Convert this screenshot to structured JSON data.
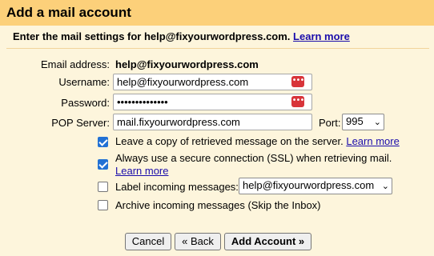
{
  "title": "Add a mail account",
  "intro": {
    "text": "Enter the mail settings for help@fixyourwordpress.com.",
    "link": "Learn more"
  },
  "form": {
    "email_label": "Email address:",
    "email_value": "help@fixyourwordpress.com",
    "username_label": "Username:",
    "username_value": "help@fixyourwordpress.com",
    "password_label": "Password:",
    "password_value": "••••••••••••••",
    "pop_label": "POP Server:",
    "pop_value": "mail.fixyourwordpress.com",
    "port_label": "Port:",
    "port_value": "995",
    "password_manager_glyph": "•••"
  },
  "options": [
    {
      "label": "Leave a copy of retrieved message on the server.",
      "link": "Learn more",
      "checked": true
    },
    {
      "label": "Always use a secure connection (SSL) when retrieving mail.",
      "link": "Learn more",
      "checked": true
    },
    {
      "label": "Label incoming messages:",
      "select_value": "help@fixyourwordpress.com",
      "checked": false
    },
    {
      "label": "Archive incoming messages (Skip the Inbox)",
      "checked": false
    }
  ],
  "buttons": {
    "cancel": "Cancel",
    "back": "« Back",
    "add": "Add Account »"
  },
  "colors": {
    "title_bar": "#fcd07a",
    "panel": "#fdf5dc",
    "link": "#1a0dab",
    "checkbox": "#2271d4",
    "password_manager": "#d8343a"
  },
  "icons": {
    "password_manager": "password-manager-icon",
    "dropdown": "chevron-down-icon"
  }
}
